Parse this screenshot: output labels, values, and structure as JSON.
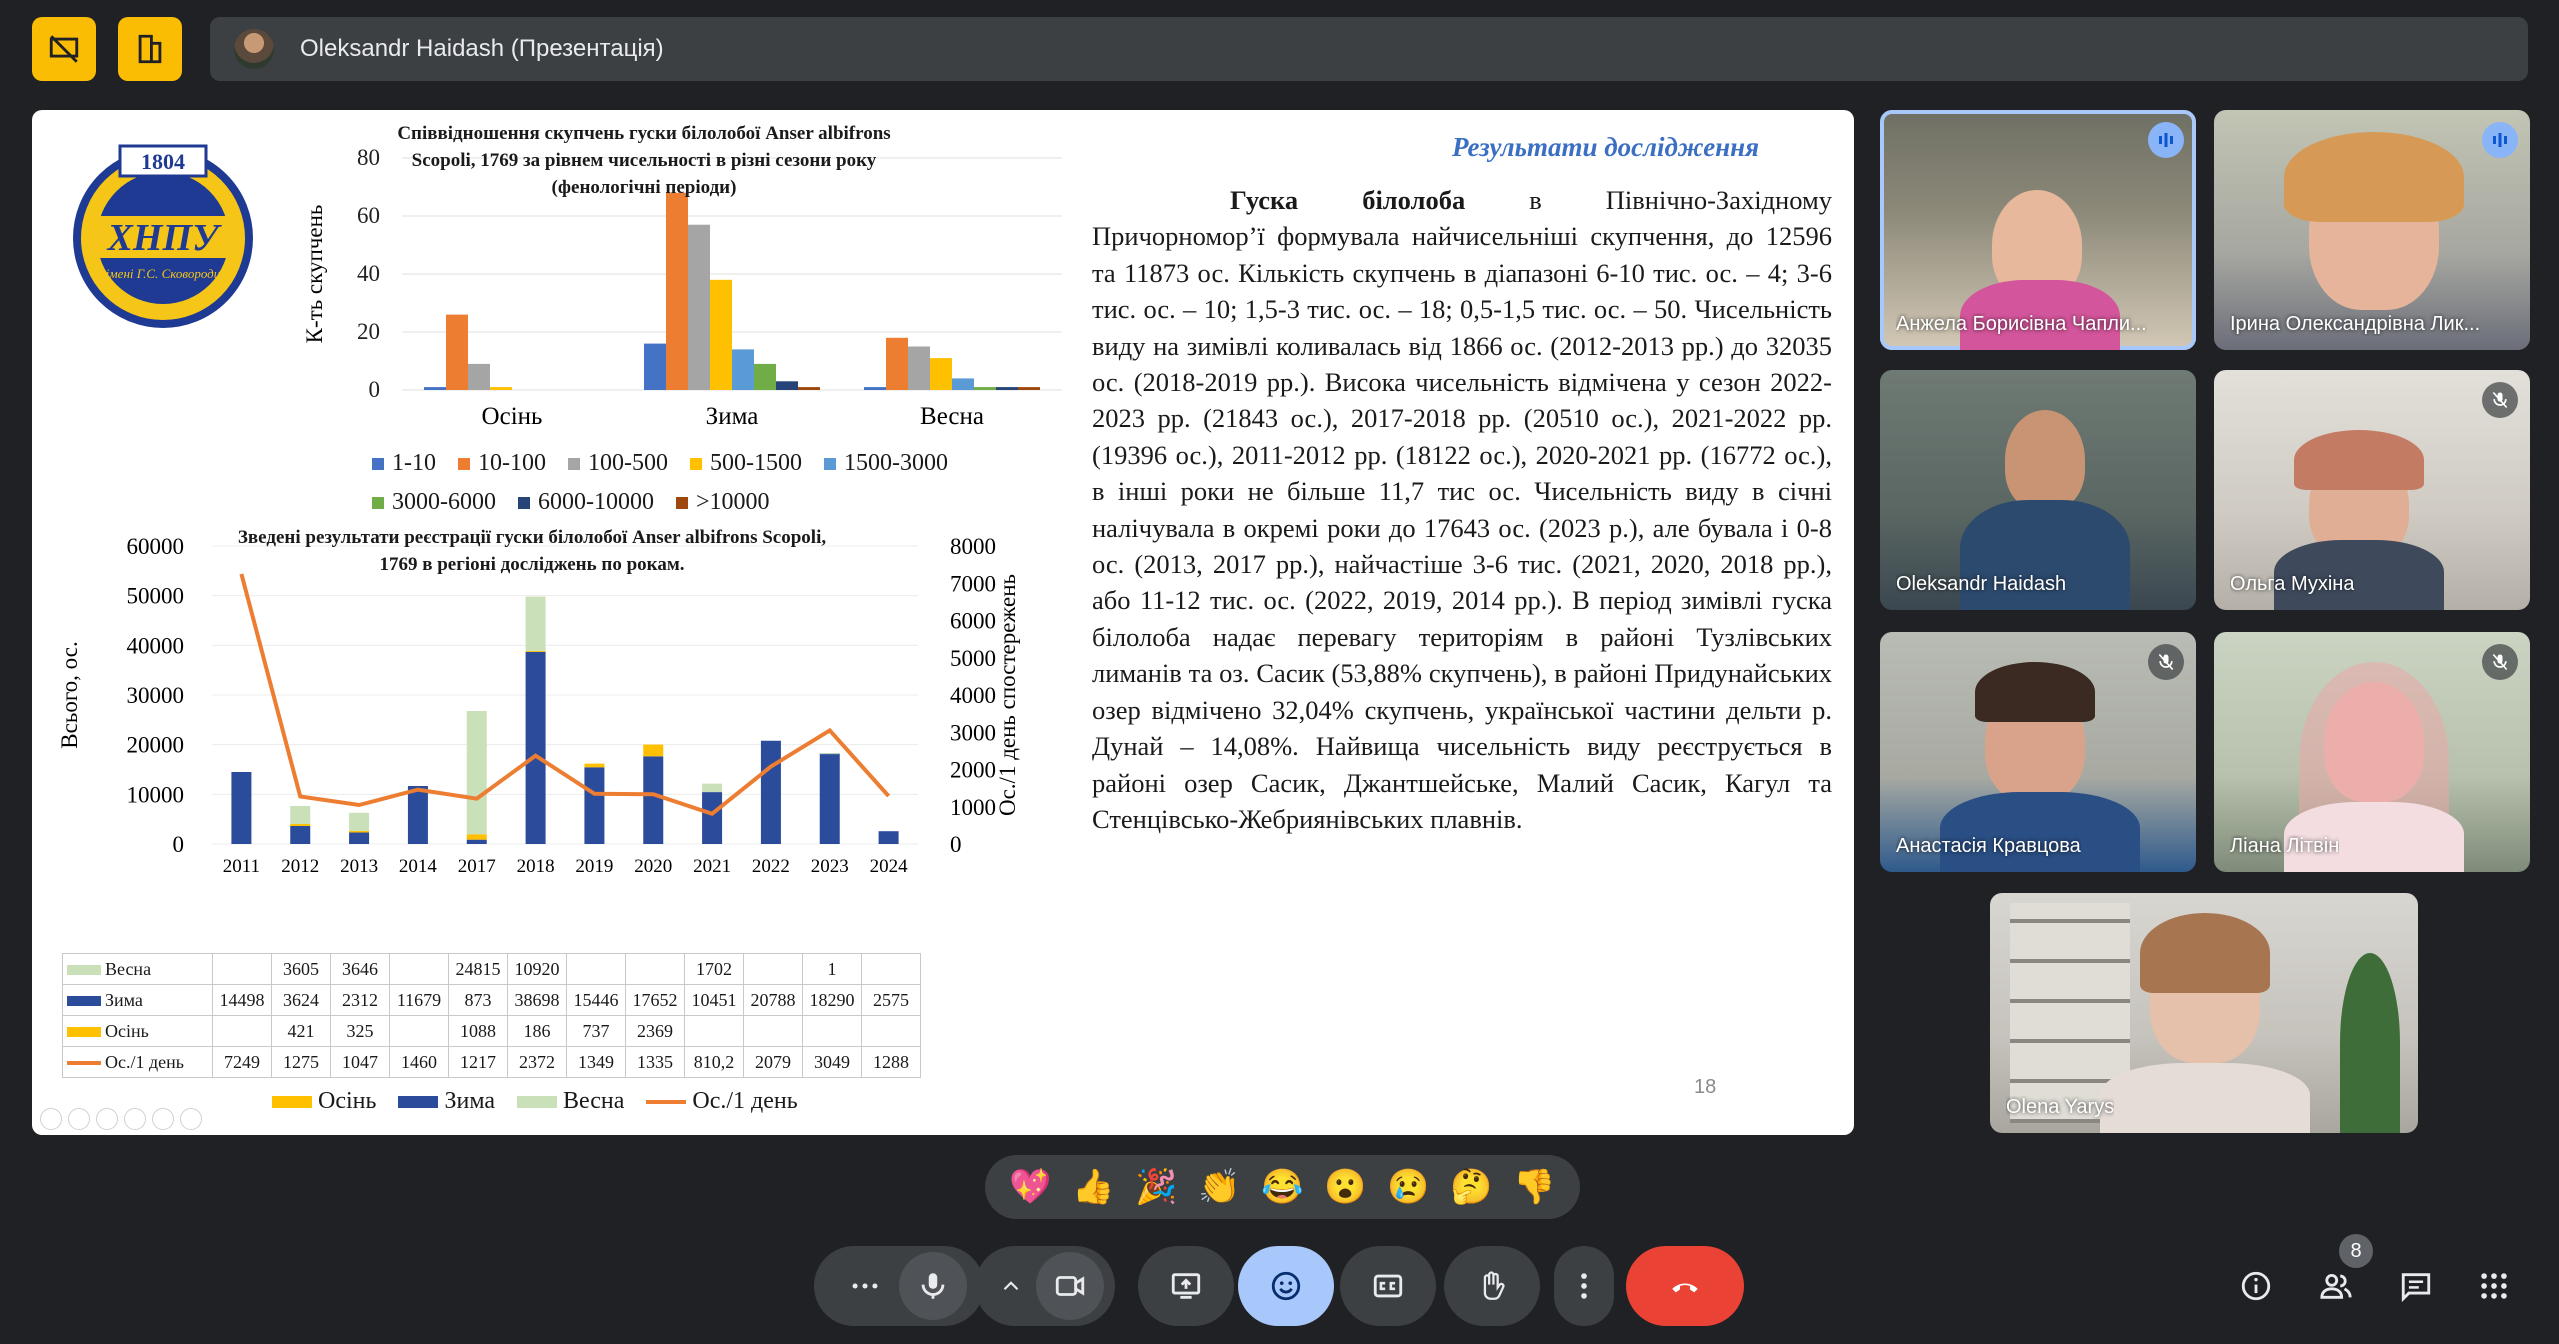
{
  "top": {
    "presenter": "Oleksandr Haidash (Презентація)"
  },
  "slide": {
    "logo": {
      "year": "1804",
      "abbr": "ХНПУ",
      "subtitle": "імені Г.С. Сковороди"
    },
    "title": "Результати дослідження",
    "body_bold": "Гуска білолоба",
    "body": " в Північно-Західному Причорномор’ї формувала найчисельніші скупчення, до 12596 та 11873 ос. Кількість скупчень в діапазоні 6-10 тис. ос. – 4; 3-6 тис. ос. – 10; 1,5-3 тис. ос. – 18; 0,5-1,5 тис. ос. – 50. Чисельність виду на зимівлі коливалась від 1866 ос. (2012-2013 рр.) до 32035 ос. (2018-2019 рр.). Висока чисельність відмічена у сезон 2022-2023 рр. (21843 ос.), 2017-2018 рр. (20510 ос.), 2021-2022 рр. (19396 ос.), 2011-2012 рр. (18122 ос.), 2020-2021 рр. (16772 ос.), в інші роки не більше 11,7 тис ос. Чисельність виду в січні налічувала в окремі роки до 17643 ос. (2023 р.), але бувала і 0-8 ос. (2013, 2017 рр.), найчастіше 3-6 тис. (2021, 2020, 2018 рр.), або 11-12 тис. ос. (2022, 2019, 2014 рр.). В період зимівлі гуска білолоба надає перевагу територіям в районі Тузлівських лиманів та оз. Сасик (53,88% скупчень), в районі Придунайських озер відмічено 32,04% скупчень, української частини дельти р. Дунай – 14,08%. Найвища чисельність виду реєструється в районі озер Сасик, Джантшейське, Малий Сасик, Кагул та Стенцівсько-Жебриянівських плавнів.",
    "page_number": "18"
  },
  "chart_data": [
    {
      "type": "bar",
      "title": "Співвідношення скупчень гуски білолобої Anser albifrons Scopoli, 1769 за рівнем чисельності в різні сезони року (фенологічні періоди)",
      "ylabel": "К-ть скупчень",
      "ylim": [
        0,
        80
      ],
      "yticks": [
        "0",
        "20",
        "40",
        "60",
        "80"
      ],
      "categories": [
        "Осінь",
        "Зима",
        "Весна"
      ],
      "series": [
        {
          "name": "1-10",
          "color": "#4472c4",
          "values": [
            1,
            16,
            1
          ]
        },
        {
          "name": "10-100",
          "color": "#ed7d31",
          "values": [
            26,
            68,
            18
          ]
        },
        {
          "name": "100-500",
          "color": "#a5a5a5",
          "values": [
            9,
            57,
            15
          ]
        },
        {
          "name": "500-1500",
          "color": "#ffc000",
          "values": [
            1,
            38,
            11
          ]
        },
        {
          "name": "1500-3000",
          "color": "#5b9bd5",
          "values": [
            0,
            14,
            4
          ]
        },
        {
          "name": "3000-6000",
          "color": "#70ad47",
          "values": [
            0,
            9,
            1
          ]
        },
        {
          "name": "6000-10000",
          "color": "#264478",
          "values": [
            0,
            3,
            1
          ]
        },
        {
          "name": ">10000",
          "color": "#9e480e",
          "values": [
            0,
            1,
            1
          ]
        }
      ]
    },
    {
      "type": "bar",
      "title": "Зведені результати реєстрації гуски білолобої Anser albifrons Scopoli, 1769 в регіоні досліджень по рокам.",
      "ylabel": "Всього, ос.",
      "y2label": "Ос./1 день спостережень",
      "ylim": [
        0,
        60000
      ],
      "y2lim": [
        0,
        8000
      ],
      "yticks": [
        "0",
        "10000",
        "20000",
        "30000",
        "40000",
        "50000",
        "60000"
      ],
      "y2ticks": [
        "0",
        "1000",
        "2000",
        "3000",
        "4000",
        "5000",
        "6000",
        "7000",
        "8000"
      ],
      "categories": [
        "2011",
        "2012",
        "2013",
        "2014",
        "2017",
        "2018",
        "2019",
        "2020",
        "2021",
        "2022",
        "2023",
        "2024"
      ],
      "series": [
        {
          "name": "Весна",
          "color": "#c9e0b8",
          "values": [
            null,
            3605,
            3646,
            null,
            24815,
            10920,
            null,
            null,
            1702,
            null,
            1,
            null
          ],
          "labels": [
            "",
            "3605",
            "3646",
            "",
            "24815",
            "10920",
            "",
            "",
            "1702",
            "",
            "1",
            ""
          ]
        },
        {
          "name": "Зима",
          "color": "#2b4b9b",
          "values": [
            14498,
            3624,
            2312,
            11679,
            873,
            38698,
            15446,
            17652,
            10451,
            20788,
            18290,
            2575
          ],
          "labels": [
            "14498",
            "3624",
            "2312",
            "11679",
            "873",
            "38698",
            "15446",
            "17652",
            "10451",
            "20788",
            "18290",
            "2575"
          ]
        },
        {
          "name": "Осінь",
          "color": "#ffc000",
          "values": [
            null,
            421,
            325,
            null,
            1088,
            186,
            737,
            2369,
            null,
            null,
            null,
            null
          ],
          "labels": [
            "",
            "421",
            "325",
            "",
            "1088",
            "186",
            "737",
            "2369",
            "",
            "",
            "",
            ""
          ]
        },
        {
          "name": "Ос./1 день",
          "color": "#ed7d31",
          "axis": "y2",
          "line": true,
          "values": [
            7249,
            1275,
            1047,
            1460,
            1217,
            2372,
            1349,
            1335,
            810.2,
            2079,
            3049,
            1288
          ],
          "labels": [
            "7249",
            "1275",
            "1047",
            "1460",
            "1217",
            "2372",
            "1349",
            "1335",
            "810,2",
            "2079",
            "3049",
            "1288"
          ]
        }
      ]
    }
  ],
  "participants": [
    {
      "name": "Анжела Борисівна Чапли...",
      "status": "speaking"
    },
    {
      "name": "Ірина Олександрівна Лик...",
      "status": "speaking"
    },
    {
      "name": "Oleksandr Haidash",
      "status": ""
    },
    {
      "name": "Ольга Мухіна",
      "status": "muted"
    },
    {
      "name": "Анастасія Кравцова",
      "status": "muted"
    },
    {
      "name": "Ліана Літвін",
      "status": "muted"
    },
    {
      "name": "Olena Yarys",
      "status": ""
    }
  ],
  "reactions": [
    "💖",
    "👍",
    "🎉",
    "👏",
    "😂",
    "😮",
    "😢",
    "🤔",
    "👎"
  ],
  "people_count": "8",
  "colors": {
    "end_call": "#ea4335",
    "active_control": "#a8c7fa",
    "top_buttons": "#fbbc04"
  }
}
